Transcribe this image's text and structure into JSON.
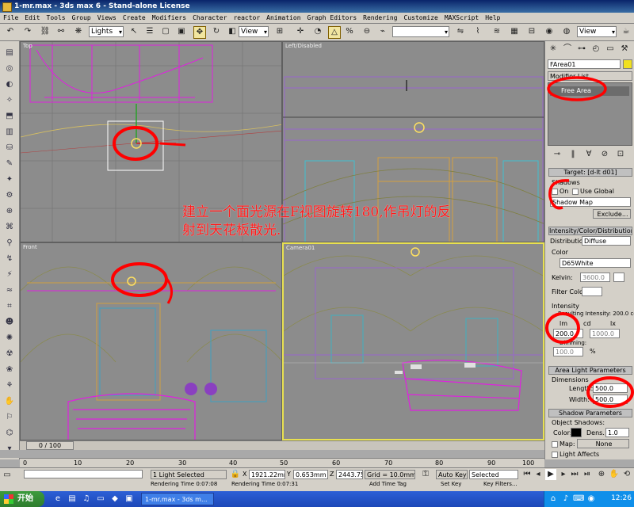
{
  "window": {
    "title": "1-mr.max - 3ds max 6 - Stand-alone License"
  },
  "menu": [
    "File",
    "Edit",
    "Tools",
    "Group",
    "Views",
    "Create",
    "Modifiers",
    "Character",
    "reactor",
    "Animation",
    "Graph Editors",
    "Rendering",
    "Customize",
    "MAXScript",
    "Help"
  ],
  "toolbar": {
    "selection_filter": "Lights",
    "ref_coord": "View",
    "named_selection": "",
    "view_dropdown": "View"
  },
  "viewports": {
    "top": {
      "label": "Top"
    },
    "left": {
      "label": "Left/Disabled"
    },
    "front": {
      "label": "Front"
    },
    "camera": {
      "label": "Camera01"
    }
  },
  "annotation": {
    "line1": "建立一个面光源在F视图旋转180,作吊灯的反",
    "line2": "射到天花板散光."
  },
  "command_panel": {
    "object_name": "FArea01",
    "modifier_list": "Modifier List",
    "stack_item": "Free Area",
    "target_rollout": "Target: [d-lt d01]",
    "shadows": {
      "title": "Shadows",
      "on": "On",
      "use_global": "Use Global",
      "type": "Shadow Map",
      "exclude": "Exclude..."
    },
    "intensity_rollout": "Intensity/Color/Distribution",
    "distribution": {
      "label": "Distribution:",
      "value": "Diffuse"
    },
    "color": {
      "title": "Color",
      "preset": "D65White",
      "kelvin_label": "Kelvin:",
      "kelvin_value": "3600.0",
      "filter_label": "Filter Color:"
    },
    "intensity": {
      "title": "Intensity",
      "resulting": "Resulting Intensity: 200.0 cd",
      "lm": "lm",
      "cd": "cd",
      "lx": "lx",
      "value": "200.0",
      "at": "1000.0",
      "dimming_label": "Dimming:",
      "dimming_value": "100.0",
      "pct": "%"
    },
    "area_rollout": "Area Light Parameters",
    "dimensions": {
      "title": "Dimensions",
      "length_label": "Length:",
      "length_value": "500.0",
      "width_label": "Width:",
      "width_value": "500.0"
    },
    "shadow_rollout": "Shadow Parameters",
    "object_shadows": {
      "title": "Object Shadows:",
      "color_label": "Color:",
      "dens_label": "Dens.",
      "dens_value": "1.0",
      "map_label": "Map:",
      "map_value": "None",
      "light_affects": "Light Affects"
    }
  },
  "timeline": {
    "frame": "0 / 100",
    "ticks": [
      "0",
      "10",
      "20",
      "30",
      "40",
      "50",
      "60",
      "70",
      "80",
      "90",
      "100"
    ]
  },
  "status": {
    "selection": "1 Light Selected",
    "x_label": "X",
    "x_value": "1921.22mm",
    "y_label": "Y",
    "y_value": "0.653mm",
    "z_label": "Z",
    "z_value": "2443.759mm",
    "grid": "Grid = 10.0mm",
    "auto_key": "Auto Key",
    "key_mode": "Selected",
    "set_key": "Set Key",
    "key_filters": "Key Filters...",
    "render_time1": "Rendering Time  0:07:08",
    "render_time2": "Rendering Time  0:07:31",
    "add_time_tag": "Add Time Tag"
  },
  "taskbar": {
    "start": "开始",
    "task": "1-mr.max - 3ds m...",
    "clock": "12:26"
  },
  "colors": {
    "annotation": "#ff1a1a",
    "magenta_wire": "#e020e0",
    "viewport_bg": "#8c8c8c",
    "active_border": "#e8e050"
  }
}
